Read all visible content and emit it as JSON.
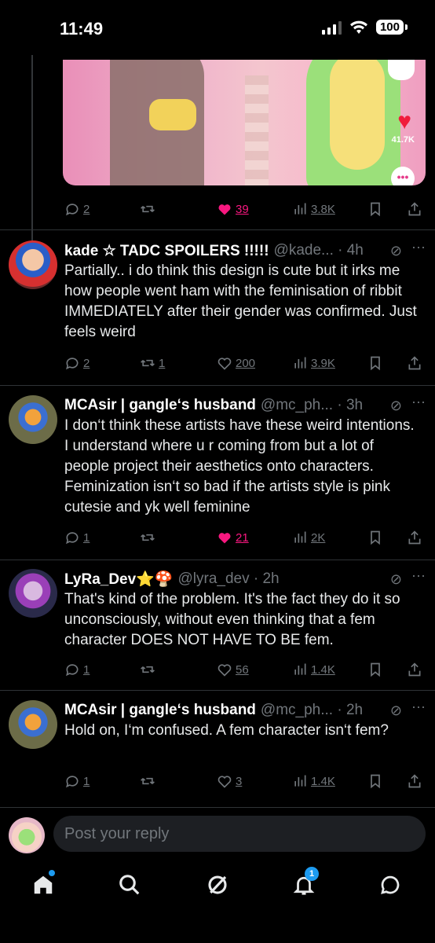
{
  "status_bar": {
    "time": "11:49",
    "battery": "100"
  },
  "media": {
    "like_count": "41.7K"
  },
  "tweets": [
    {
      "actions": {
        "replies": "2",
        "retweets": "",
        "likes": "39",
        "views": "3.8K"
      }
    },
    {
      "name": "kade ☆ TADC SPOILERS !!!!!",
      "handle": "@kade... · 4h",
      "text": "Partially.. i do think this design is cute but it irks me how people went ham with the feminisation of ribbit IMMEDIATELY after their gender was confirmed. Just feels weird",
      "actions": {
        "replies": "2",
        "retweets": "1",
        "likes": "200",
        "views": "3.9K"
      }
    },
    {
      "name": "MCAsir | gangle‘s husband",
      "handle": "@mc_ph... · 3h",
      "text": "I don‘t think these artists have these weird intentions. I understand where u r coming from but a lot of people project their aesthetics onto characters. Feminization isn‘t so bad if the artists style is pink cutesie and yk well feminine",
      "actions": {
        "replies": "1",
        "retweets": "",
        "likes": "21",
        "views": "2K"
      }
    },
    {
      "name": "LyRa_Dev⭐🍄",
      "handle": "@lyra_dev · 2h",
      "text": "That's kind of the problem. It's the fact they do it so unconsciously, without even thinking that a fem character DOES NOT HAVE TO BE fem.",
      "actions": {
        "replies": "1",
        "retweets": "",
        "likes": "56",
        "views": "1.4K"
      }
    },
    {
      "name": "MCAsir | gangle‘s husband",
      "handle": "@mc_ph... · 2h",
      "text": "Hold on, I‘m confused. A fem character isn‘t fem?",
      "actions": {
        "replies": "1",
        "retweets": "",
        "likes": "3",
        "views": "1.4K"
      }
    }
  ],
  "reply": {
    "placeholder": "Post your reply"
  },
  "nav": {
    "notifications_count": "1"
  },
  "colors": {
    "like": "#f91880",
    "accent": "#1d9bf0",
    "muted": "#71767b"
  }
}
